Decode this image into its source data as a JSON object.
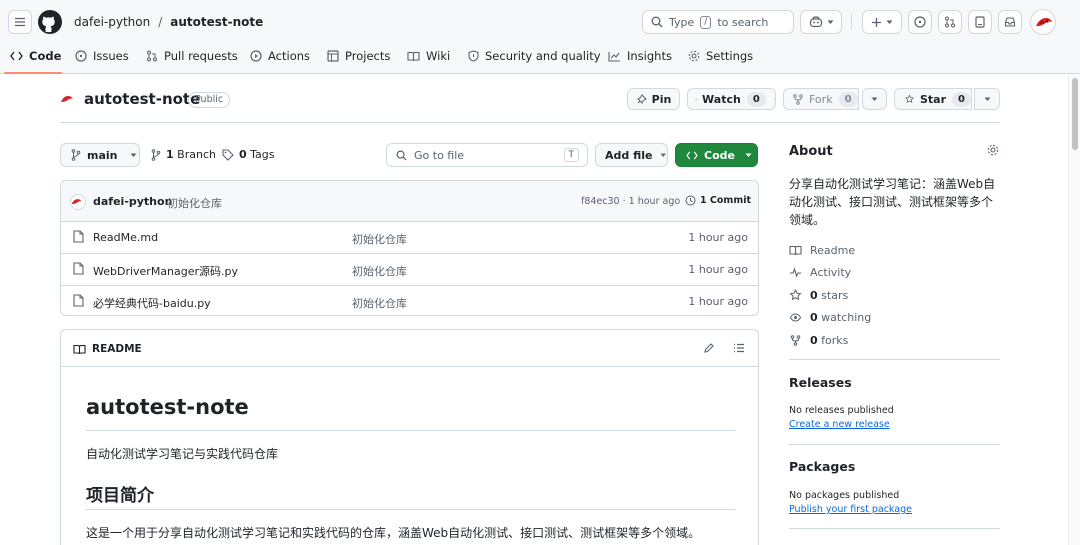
{
  "header": {
    "owner": "dafei-python",
    "separator": "/",
    "repo": "autotest-note",
    "search_prefix": "Type",
    "search_key": "/",
    "search_suffix": "to search"
  },
  "tabs": [
    {
      "label": "Code"
    },
    {
      "label": "Issues"
    },
    {
      "label": "Pull requests"
    },
    {
      "label": "Actions"
    },
    {
      "label": "Projects"
    },
    {
      "label": "Wiki"
    },
    {
      "label": "Security and quality"
    },
    {
      "label": "Insights"
    },
    {
      "label": "Settings"
    }
  ],
  "repo": {
    "name": "autotest-note",
    "visibility": "Public",
    "pin": "Pin",
    "watch": "Watch",
    "watch_count": "0",
    "fork": "Fork",
    "fork_count": "0",
    "star": "Star",
    "star_count": "0"
  },
  "toolbar": {
    "branch": "main",
    "branch_count": "1",
    "branch_label": "Branch",
    "tag_count": "0",
    "tag_label": "Tags",
    "goto_placeholder": "Go to file",
    "goto_key": "T",
    "add_file": "Add file",
    "code": "Code"
  },
  "commit": {
    "author": "dafei-python",
    "message": "初始化仓库",
    "hash_time": "f84ec30 · 1 hour ago",
    "commits": "1 Commit"
  },
  "files": [
    {
      "name": "ReadMe.md",
      "message": "初始化仓库",
      "time": "1 hour ago"
    },
    {
      "name": "WebDriverManager源码.py",
      "message": "初始化仓库",
      "time": "1 hour ago"
    },
    {
      "name": "必学经典代码-baidu.py",
      "message": "初始化仓库",
      "time": "1 hour ago"
    }
  ],
  "readme": {
    "tab": "README",
    "title": "autotest-note",
    "subtitle": "自动化测试学习笔记与实践代码仓库",
    "h2": "项目简介",
    "para": "这是一个用于分享自动化测试学习笔记和实践代码的仓库，涵盖Web自动化测试、接口测试、测试框架等多个领域。"
  },
  "about": {
    "title": "About",
    "description": "分享自动化测试学习笔记：涵盖Web自动化测试、接口测试、测试框架等多个领域。",
    "readme": "Readme",
    "activity": "Activity",
    "stars_count": "0",
    "stars": "stars",
    "watching_count": "0",
    "watching": "watching",
    "forks_count": "0",
    "forks": "forks"
  },
  "releases": {
    "title": "Releases",
    "empty": "No releases published",
    "link": "Create a new release"
  },
  "packages": {
    "title": "Packages",
    "empty": "No packages published",
    "link": "Publish your first package"
  },
  "colors": {
    "accent": "#1f883d",
    "link": "#0969da",
    "tab_underline": "#fd8c73",
    "avatar": "#d62828"
  }
}
